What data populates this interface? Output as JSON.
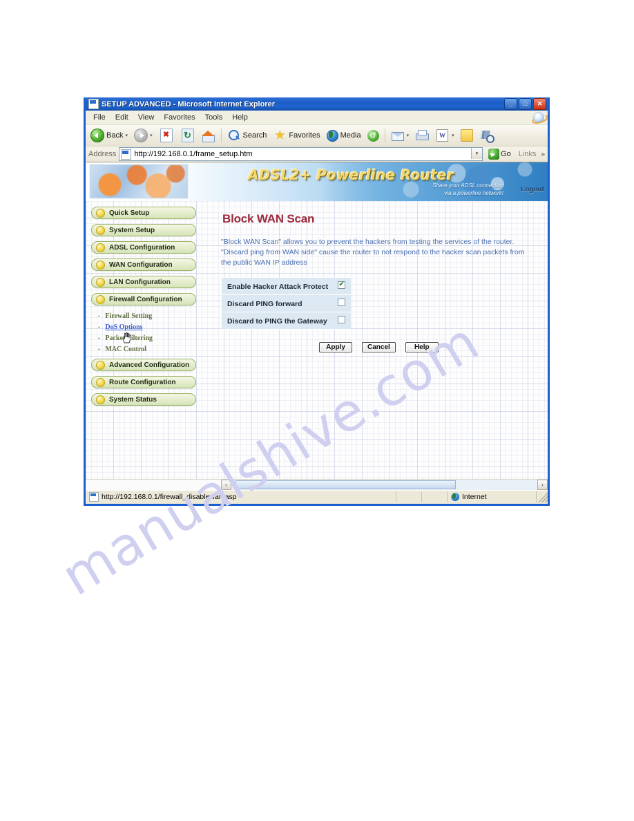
{
  "window": {
    "title": "SETUP ADVANCED - Microsoft Internet Explorer",
    "title_icon": "page-icon",
    "minimize_label": "_",
    "maximize_label": "□",
    "close_label": "✕"
  },
  "menubar": {
    "items": [
      {
        "label": "File"
      },
      {
        "label": "Edit"
      },
      {
        "label": "View"
      },
      {
        "label": "Favorites"
      },
      {
        "label": "Tools"
      },
      {
        "label": "Help"
      }
    ]
  },
  "toolbar": {
    "back_label": "Back",
    "search_label": "Search",
    "favorites_label": "Favorites",
    "media_label": "Media",
    "caret": "▾",
    "icons": [
      "back-icon",
      "forward-icon",
      "stop-icon",
      "refresh-icon",
      "home-icon",
      "search-icon",
      "favorites-star-icon",
      "media-icon",
      "history-icon",
      "mail-icon",
      "print-icon",
      "edit-icon",
      "note-icon",
      "messenger-icon"
    ]
  },
  "address_bar": {
    "label": "Address",
    "url": "http://192.168.0.1/frame_setup.htm",
    "dropdown_caret": "▾",
    "go_label": "Go",
    "links_label": "Links",
    "links_caret": "»"
  },
  "banner": {
    "title": "ADSL2+ Powerline Router",
    "subtitle_line1": "Share your ADSL connection",
    "subtitle_line2": "via a powerline network!",
    "logout_label": "Logout"
  },
  "sidebar": {
    "items": [
      {
        "label": "Quick Setup"
      },
      {
        "label": "System Setup"
      },
      {
        "label": "ADSL Configuration"
      },
      {
        "label": "WAN Configuration"
      },
      {
        "label": "LAN Configuration"
      },
      {
        "label": "Firewall Configuration"
      }
    ],
    "sub_items": [
      {
        "label": "Firewall Setting",
        "active": false
      },
      {
        "label": "DoS Options",
        "active": true
      },
      {
        "label": "Packet Filtering",
        "active": false
      },
      {
        "label": "MAC Control",
        "active": false
      }
    ],
    "items_after": [
      {
        "label": "Advanced Configuration"
      },
      {
        "label": "Route Configuration"
      },
      {
        "label": "System Status"
      }
    ],
    "dash": "-"
  },
  "main": {
    "title": "Block WAN Scan",
    "description": "\"Block WAN Scan\" allows you to prevent the hackers from testing the services of the router. \"Discard ping from WAN side\" cause the router to not respond to the hacker scan packets from the public WAN IP address",
    "options": [
      {
        "label": "Enable Hacker Attack Protect",
        "checked": true
      },
      {
        "label": "Discard PING forward",
        "checked": false
      },
      {
        "label": "Discard to PING the Gateway",
        "checked": false
      }
    ],
    "buttons": [
      {
        "label": "Apply"
      },
      {
        "label": "Cancel"
      },
      {
        "label": "Help"
      }
    ]
  },
  "scrollbar": {
    "left_arrow": "‹",
    "right_arrow": "›"
  },
  "statusbar": {
    "url": "http://192.168.0.1/firewall_disablewan.asp",
    "zone": "Internet"
  },
  "watermark": {
    "text": "manualshive.com"
  },
  "colors": {
    "titlebar_blue": "#1c5ec9",
    "heading_maroon": "#9c2a3c",
    "desc_blue": "#4a6fb0",
    "sidebar_green": "#d6e4b8",
    "bullet_gold": "#f3d94e",
    "option_row_bg": "#dce9f2",
    "link_blue": "#3c5fd0",
    "watermark_lavender": "#cfcff0"
  }
}
